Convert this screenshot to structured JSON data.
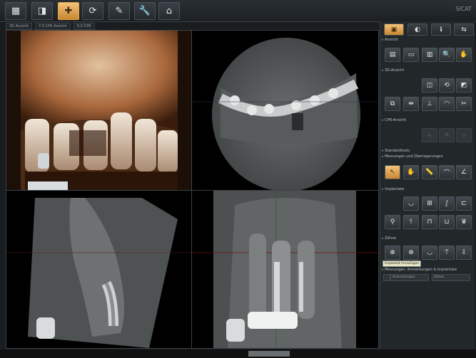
{
  "toolbar": {
    "buttons": [
      {
        "name": "grid-view-icon",
        "glyph": "▦",
        "active": false
      },
      {
        "name": "volume-icon",
        "glyph": "◨",
        "active": false
      },
      {
        "name": "tooth-icon",
        "glyph": "✚",
        "active": true
      },
      {
        "name": "rotate-icon",
        "glyph": "⟳",
        "active": false
      },
      {
        "name": "measure-icon",
        "glyph": "✎",
        "active": false
      },
      {
        "name": "wrench-icon",
        "glyph": "🔧",
        "active": false
      },
      {
        "name": "home-icon",
        "glyph": "⌂",
        "active": false
      }
    ],
    "logo": "SICAT"
  },
  "tabs": [
    "3D Ansicht",
    "Y-Z-CPR Ansicht",
    "X-Z-CPR"
  ],
  "panel": {
    "sections": {
      "ansicht": "Ansicht",
      "ansicht_3d": "3D-Ansicht",
      "cpr": "CPR-Ansicht",
      "standard": "Standardtools",
      "messungen": "Messungen und Überlagerungen",
      "implantate": "Implantate",
      "zaehne": "Zähne",
      "liste": "Messungen, Anmerkungen & Implantate"
    },
    "tooltip": "Implantat hinzufügen",
    "list_fields": [
      "Anmerkungen",
      "Status"
    ]
  },
  "colors": {
    "accent": "#e7a64b",
    "panel": "#22272a"
  }
}
